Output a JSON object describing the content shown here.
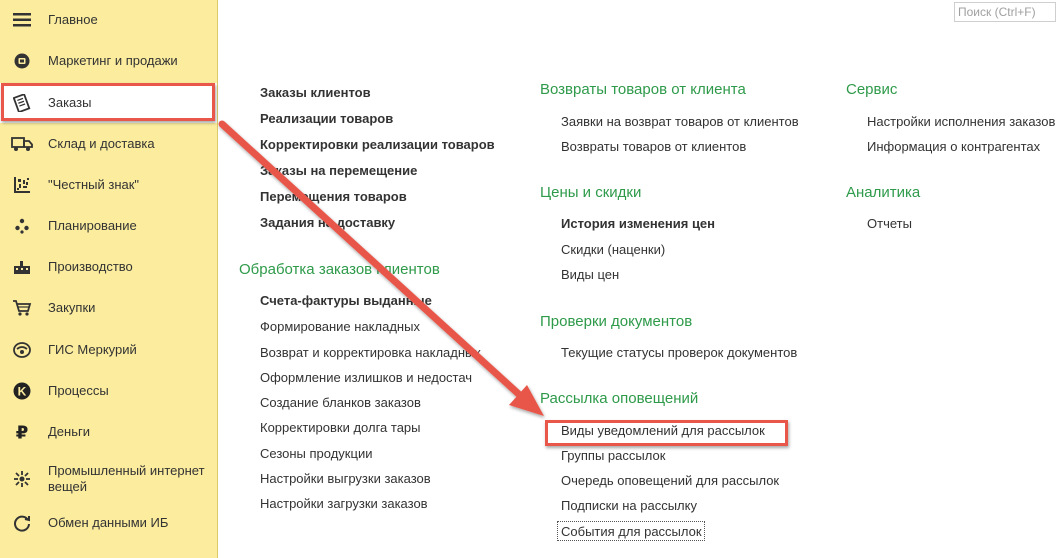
{
  "search": {
    "placeholder": "Поиск (Ctrl+F)"
  },
  "sidebar": {
    "items": [
      {
        "label": "Главное",
        "icon": "hamburger-menu-icon"
      },
      {
        "label": "Маркетинг и продажи",
        "icon": "marketing-icon"
      },
      {
        "label": "Заказы",
        "icon": "orders-icon",
        "active": true
      },
      {
        "label": "Склад и доставка",
        "icon": "delivery-truck-icon"
      },
      {
        "label": "\"Честный знак\"",
        "icon": "datamatrix-icon"
      },
      {
        "label": "Планирование",
        "icon": "planning-icon"
      },
      {
        "label": "Производство",
        "icon": "factory-icon"
      },
      {
        "label": "Закупки",
        "icon": "shopping-cart-icon"
      },
      {
        "label": "ГИС Меркурий",
        "icon": "mercury-icon"
      },
      {
        "label": "Процессы",
        "icon": "processes-icon"
      },
      {
        "label": "Деньги",
        "icon": "ruble-icon"
      },
      {
        "label": "Промышленный интернет вещей",
        "icon": "iot-icon"
      },
      {
        "label": "Обмен данными ИБ",
        "icon": "data-exchange-icon"
      }
    ]
  },
  "main": {
    "col1": {
      "links": [
        "Заказы клиентов",
        "Реализации товаров",
        "Корректировки реализации товаров",
        "Заказы на перемещение",
        "Перемещения товаров",
        "Задания на доставку"
      ],
      "section_title": "Обработка заказов клиентов",
      "section_links": [
        "Счета-фактуры выданные",
        "Формирование накладных",
        "Возврат и корректировка накладных",
        "Оформление излишков и недостач",
        "Создание бланков заказов",
        "Корректировки долга тары",
        "Сезоны продукции",
        "Настройки выгрузки заказов",
        "Настройки загрузки заказов"
      ]
    },
    "col2": {
      "returns_title": "Возвраты товаров от клиента",
      "returns_links": [
        "Заявки на возврат товаров от клиентов",
        "Возвраты товаров от клиентов"
      ],
      "prices_title": "Цены и скидки",
      "prices_links": [
        "История изменения цен",
        "Скидки (наценки)",
        "Виды цен"
      ],
      "checks_title": "Проверки документов",
      "checks_links": [
        "Текущие статусы проверок документов"
      ],
      "mailing_title": "Рассылка оповещений",
      "mailing_links": [
        "Виды уведомлений для рассылок",
        "Группы рассылок",
        "Очередь оповещений для рассылок",
        "Подписки на рассылку",
        "События для рассылок"
      ]
    },
    "col3": {
      "service_title": "Сервис",
      "service_links": [
        "Настройки исполнения заказов",
        "Информация о контрагентах"
      ],
      "analytics_title": "Аналитика",
      "analytics_links": [
        "Отчеты"
      ]
    }
  },
  "colors": {
    "sidebar_bg": "#fbec9e",
    "section_header": "#2e9a4a",
    "highlight": "#e8574a"
  }
}
